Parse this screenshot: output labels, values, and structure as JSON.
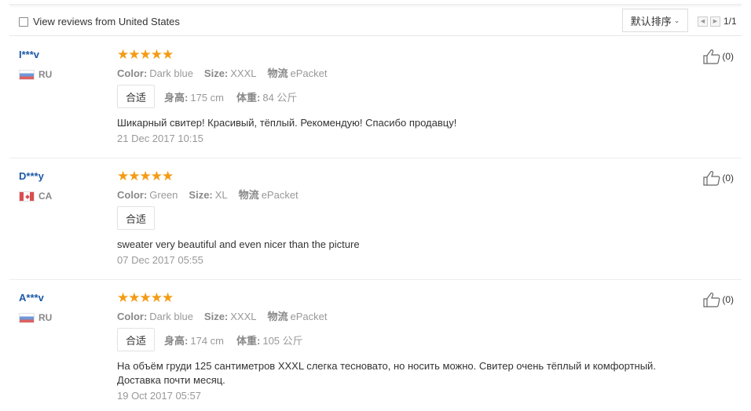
{
  "filter": {
    "label": "View reviews from United States",
    "checked": false
  },
  "sort": {
    "label": "默认排序",
    "chevron": "chevron-down-icon"
  },
  "pager": {
    "page": "1/1",
    "prev_icon": "triangle-left-icon",
    "next_icon": "triangle-right-icon"
  },
  "colors": {
    "accent_star": "#f49b14",
    "name_blue": "#1c5aa6"
  },
  "reviews": [
    {
      "name": "I***v",
      "country": "RU",
      "flag": "flag-russia",
      "stars": 5,
      "color_label": "Color:",
      "color_value": "Dark blue",
      "size_label": "Size:",
      "size_value": "XXXL",
      "ship_label": "物流",
      "ship_value": "ePacket",
      "fit": "合适",
      "height_label": "身高:",
      "height_value": "175 cm",
      "weight_label": "体重:",
      "weight_value": "84 公斤",
      "comment": "Шикарный свитер! Красивый, тёплый. Рекомендую! Спасибо продавцу!",
      "date": "21 Dec 2017 10:15",
      "helpful": "(0)"
    },
    {
      "name": "D***y",
      "country": "CA",
      "flag": "flag-canada",
      "stars": 5,
      "color_label": "Color:",
      "color_value": "Green",
      "size_label": "Size:",
      "size_value": "XL",
      "ship_label": "物流",
      "ship_value": "ePacket",
      "fit": "合适",
      "comment": "sweater very beautiful and even nicer than the picture",
      "date": "07 Dec 2017 05:55",
      "helpful": "(0)"
    },
    {
      "name": "A***v",
      "country": "RU",
      "flag": "flag-russia",
      "stars": 5,
      "color_label": "Color:",
      "color_value": "Dark blue",
      "size_label": "Size:",
      "size_value": "XXXL",
      "ship_label": "物流",
      "ship_value": "ePacket",
      "fit": "合适",
      "height_label": "身高:",
      "height_value": "174 cm",
      "weight_label": "体重:",
      "weight_value": "105 公斤",
      "comment": "На объём груди 125 сантиметров XXXL слегка тесновато, но носить можно. Свитер очень тёплый и комфортный. Доставка почти месяц.",
      "date": "19 Oct 2017 05:57",
      "helpful": "(0)"
    }
  ]
}
